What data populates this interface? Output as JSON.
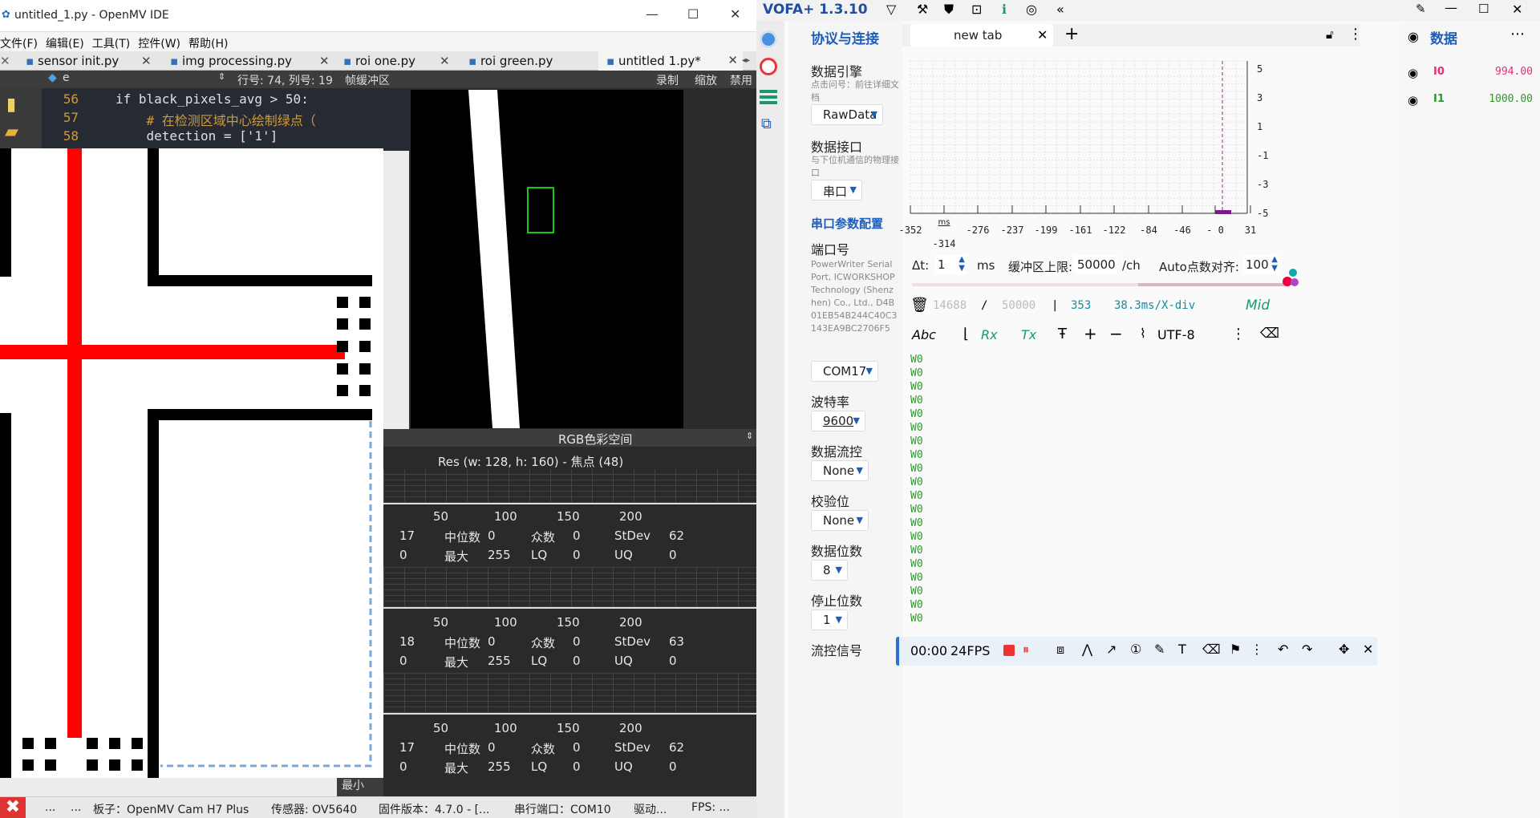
{
  "omv": {
    "title": "untitled_1.py - OpenMV IDE",
    "menu": [
      "文件(F)",
      "编辑(E)",
      "工具(T)",
      "控件(W)",
      "帮助(H)"
    ],
    "tabs": [
      "sensor init.py",
      "img processing.py",
      "roi one.py",
      "roi green.py",
      "untitled 1.py*"
    ],
    "bar": {
      "filter": "e",
      "position": "行号: 74, 列号: 19",
      "fb_label": "帧缓冲区",
      "record": "录制",
      "zoom": "缩放",
      "disable": "禁用"
    },
    "code": [
      {
        "n": "56",
        "t": "if black_pixels_avg > 50:"
      },
      {
        "n": "57",
        "t": "    # 在检测区域中心绘制绿点（"
      },
      {
        "n": "58",
        "t": "    detection = ['1']"
      }
    ],
    "colorspace": "RGB色彩空间",
    "res": "Res  (w: 128,  h: 160)  - 焦点  (48)",
    "hist": [
      {
        "ticks": [
          "50",
          "100",
          "150",
          "200"
        ],
        "r1": [
          "17",
          "中位数",
          "0",
          "众数",
          "0",
          "StDev",
          "62"
        ],
        "r2": [
          "0",
          "最大",
          "255",
          "LQ",
          "0",
          "UQ",
          "0"
        ]
      },
      {
        "ticks": [
          "50",
          "100",
          "150",
          "200"
        ],
        "r1": [
          "18",
          "中位数",
          "0",
          "众数",
          "0",
          "StDev",
          "63"
        ],
        "r2": [
          "0",
          "最大",
          "255",
          "LQ",
          "0",
          "UQ",
          "0"
        ]
      },
      {
        "ticks": [
          "50",
          "100",
          "150",
          "200"
        ],
        "r1": [
          "17",
          "中位数",
          "0",
          "众数",
          "0",
          "StDev",
          "62"
        ],
        "r2": [
          "0",
          "最大",
          "255",
          "LQ",
          "0",
          "UQ",
          "0"
        ]
      }
    ],
    "minimize": "最小",
    "status": {
      "dots": "...",
      "board": "板子：OpenMV Cam H7 Plus",
      "sensor": "传感器: OV5640",
      "fw": "固件版本：4.7.0 - [...",
      "port": "串行端口：COM10",
      "driver": "驱动...",
      "fps": "FPS: ..."
    }
  },
  "vofa": {
    "title": "VOFA+ 1.3.10",
    "side": {
      "header": "协议与连接",
      "engine_label": "数据引擎",
      "engine_hint": "点击问号：前往详细文档",
      "engine": "RawData",
      "iface_label": "数据接口",
      "iface_hint": "与下位机通信的物理接口",
      "iface": "串口",
      "serial_header": "串口参数配置",
      "port_label": "端口号",
      "port_desc": "PowerWriter Serial Port, ICWORKSHOP Technology (Shenzhen) Co., Ltd., D4B01EB54B244C40C3143EA9BC2706F5",
      "port": "COM17",
      "baud_label": "波特率",
      "baud": "9600",
      "flow_label": "数据流控",
      "flow": "None",
      "parity_label": "校验位",
      "parity": "None",
      "databits_label": "数据位数",
      "databits": "8",
      "stopbits_label": "停止位数",
      "stopbits": "1",
      "flowsig_label": "流控信号"
    },
    "tab": "new tab",
    "plot": {
      "x_ticks": [
        "-352",
        "-314",
        "-276",
        "-237",
        "-199",
        "-161",
        "-122",
        "-84",
        "-46",
        "- 0",
        "31"
      ],
      "x_unit": "ms",
      "y_ticks": [
        "5",
        "3",
        "1",
        "-1",
        "-3",
        "-5"
      ]
    },
    "params": {
      "dt_label": "Δt:",
      "dt": "1",
      "dt_unit": "ms",
      "buf_label": "缓冲区上限:",
      "buf": "50000",
      "buf_unit": "/ch",
      "auto_label": "Auto点数对齐:",
      "auto": "100"
    },
    "counts": {
      "a": "14688",
      "sep1": "/",
      "b": "50000",
      "sep2": "|",
      "c": "353",
      "div": "38.3ms/X-div",
      "mid": "Mid"
    },
    "toolbar": {
      "abc": "Abc",
      "rx": "Rx",
      "tx": "Tx",
      "enc": "UTF-8"
    },
    "console": [
      "W0",
      "W0",
      "W0",
      "W0",
      "W0",
      "W0",
      "W0",
      "W0",
      "W0",
      "W0",
      "W0",
      "W0",
      "W0",
      "W0",
      "W0",
      "W0",
      "W0",
      "W0",
      "W0",
      "W0"
    ],
    "rec": {
      "time": "00:00",
      "fps": "24FPS"
    },
    "right": {
      "header": "数据",
      "ch": [
        {
          "name": "I0",
          "value": "994.00",
          "color": "#e0307a"
        },
        {
          "name": "I1",
          "value": "1000.00",
          "color": "#2a9a2a"
        }
      ]
    }
  }
}
